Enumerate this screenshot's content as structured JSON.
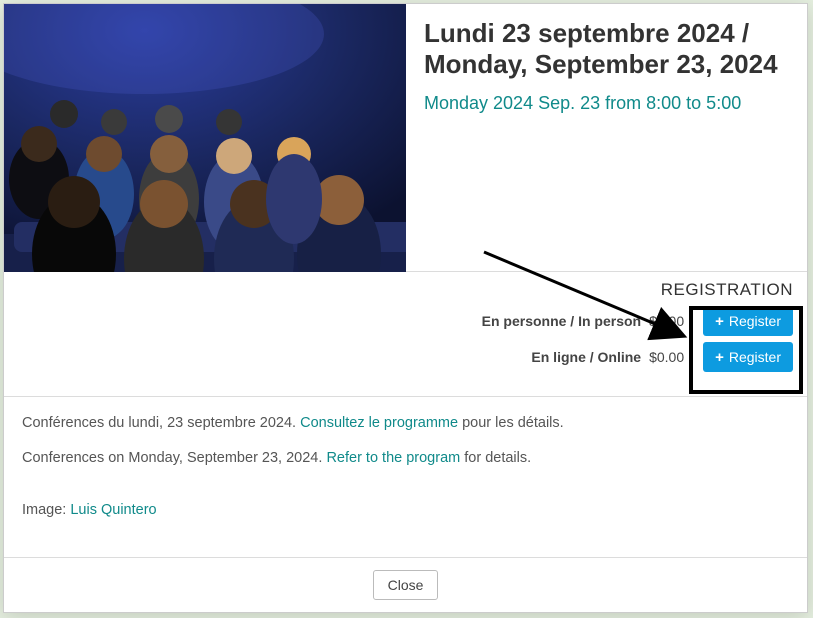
{
  "header": {
    "title": "Lundi 23 septembre 2024 / Monday, September 23, 2024",
    "subtitle": "Monday 2024 Sep. 23 from 8:00 to 5:00"
  },
  "registration": {
    "heading": "REGISTRATION",
    "options": [
      {
        "label": "En personne / In person",
        "price": "$0.00",
        "button": "Register"
      },
      {
        "label": "En ligne / Online",
        "price": "$0.00",
        "button": "Register"
      }
    ]
  },
  "description": {
    "line1_pre": "Conférences du lundi, 23 septembre 2024. ",
    "line1_link": "Consultez le programme",
    "line1_post": " pour les détails.",
    "line2_pre": "Conferences on Monday, September 23, 2024. ",
    "line2_link": "Refer to the program",
    "line2_post": " for details.",
    "image_label": "Image: ",
    "image_credit": "Luis Quintero"
  },
  "footer": {
    "close": "Close"
  },
  "colors": {
    "accent_teal": "#108a8a",
    "button_blue": "#0d9be0"
  }
}
